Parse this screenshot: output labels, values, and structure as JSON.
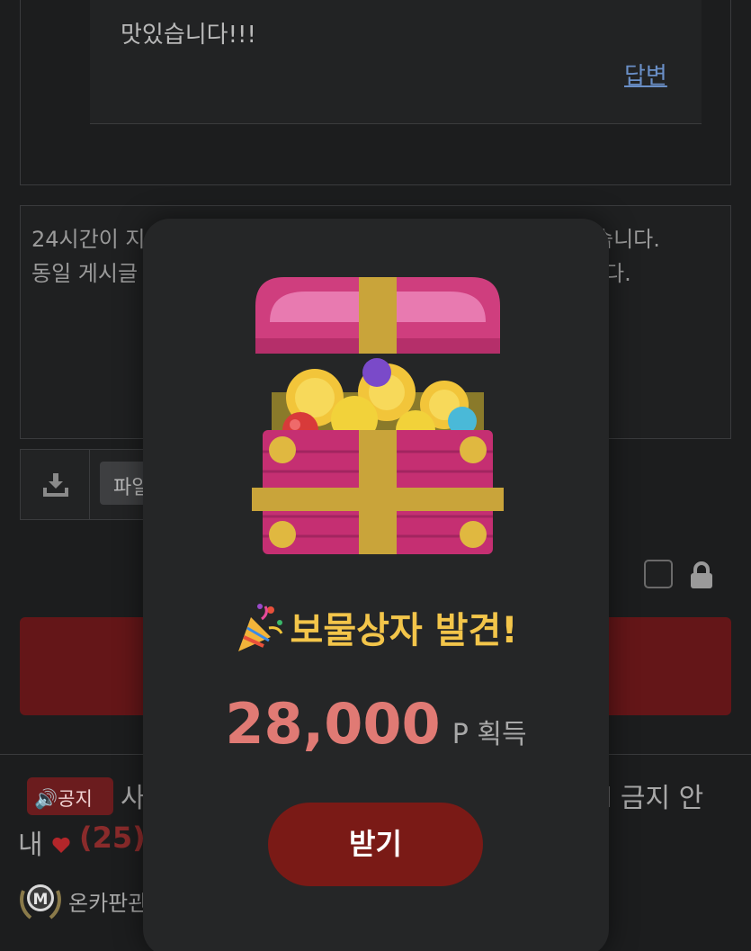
{
  "comment": {
    "reply_text": "맛있습니다!!!",
    "reply_link_label": "답변"
  },
  "editor": {
    "line1_start": "24시간이 지",
    "line1_end": "습니다.",
    "line2_start": "동일 게시글",
    "line2_end": "다."
  },
  "upload": {
    "file_button_label": "파일"
  },
  "notice": {
    "badge_label": "🔊공지",
    "title_start": "사",
    "title_end": "l 금지 안",
    "line2_start": "내",
    "like_count": "(25)",
    "author_name": "온카판관"
  },
  "modal": {
    "title": "보물상자 발견!",
    "reward_amount": "28,000",
    "reward_unit": "P 획득",
    "claim_button_label": "받기"
  },
  "colors": {
    "background": "#1c1d1e",
    "modal_bg": "#252627",
    "title_gold": "#f3c54a",
    "reward_red": "#e07a74",
    "button_red": "#7a1a16",
    "link_blue": "#6a8fc7"
  }
}
